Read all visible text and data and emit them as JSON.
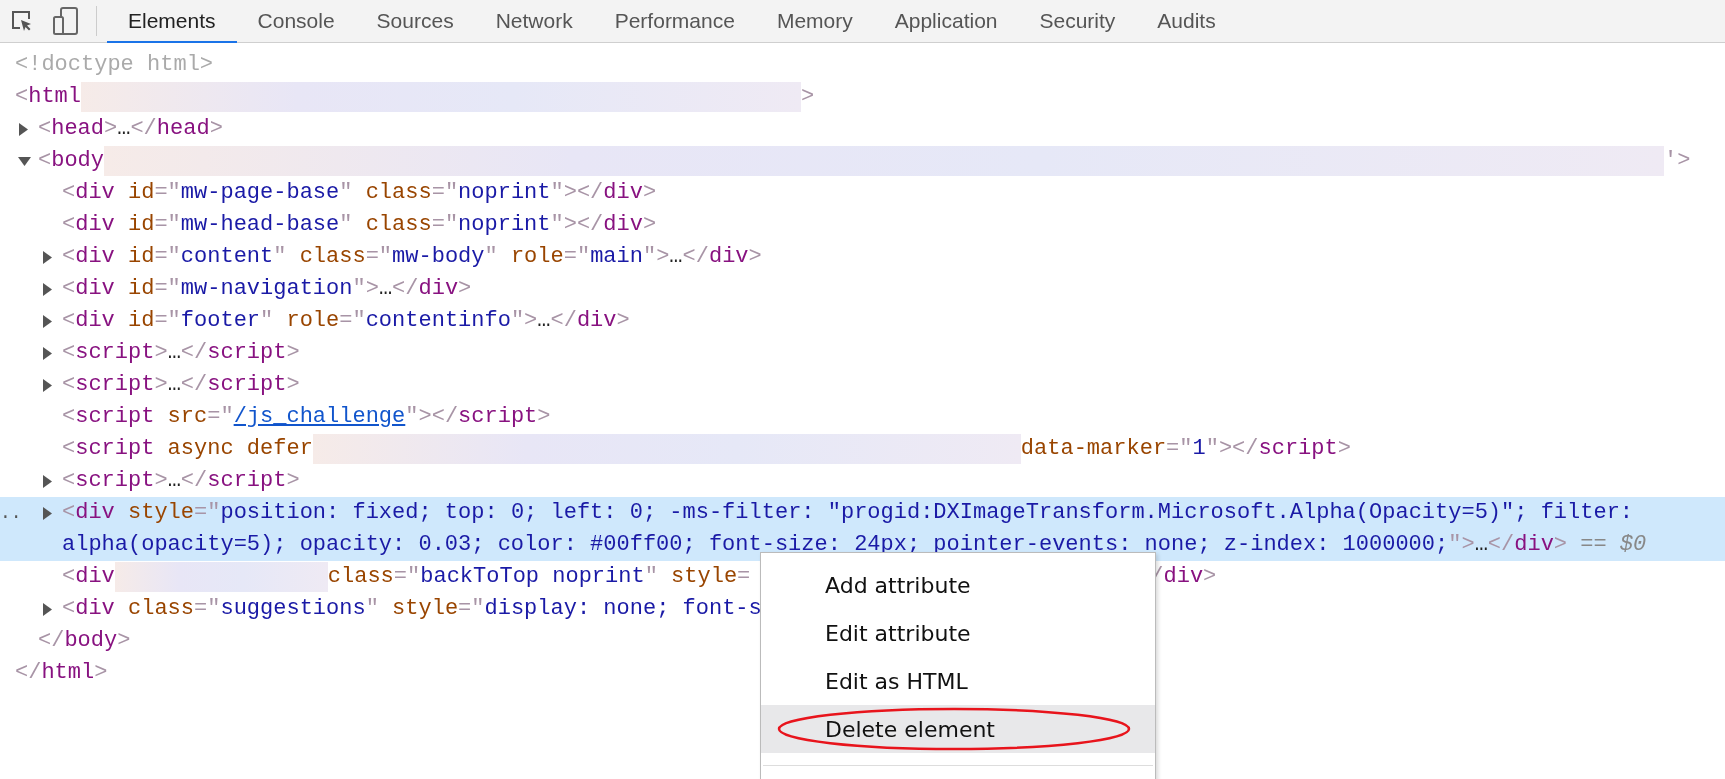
{
  "toolbar": {
    "tabs": [
      {
        "label": "Elements",
        "selected": true
      },
      {
        "label": "Console",
        "selected": false
      },
      {
        "label": "Sources",
        "selected": false
      },
      {
        "label": "Network",
        "selected": false
      },
      {
        "label": "Performance",
        "selected": false
      },
      {
        "label": "Memory",
        "selected": false
      },
      {
        "label": "Application",
        "selected": false
      },
      {
        "label": "Security",
        "selected": false
      },
      {
        "label": "Audits",
        "selected": false
      }
    ]
  },
  "dom_tree": [
    {
      "selected": false,
      "tokens": [
        {
          "kind": "comment",
          "text": "<!doctype html>"
        }
      ]
    },
    {
      "selected": false,
      "tokens": [
        {
          "kind": "punct",
          "text": "<"
        },
        {
          "kind": "tag",
          "text": "html"
        },
        {
          "kind": "redacted"
        },
        {
          "kind": "punct",
          "text": ">"
        }
      ],
      "children": [
        {
          "expandable": true,
          "expanded": false,
          "selected": false,
          "tokens": [
            {
              "kind": "punct",
              "text": "<"
            },
            {
              "kind": "tag",
              "text": "head"
            },
            {
              "kind": "punct",
              "text": ">"
            },
            {
              "kind": "text",
              "text": "…"
            },
            {
              "kind": "punct",
              "text": "</"
            },
            {
              "kind": "tag",
              "text": "head"
            },
            {
              "kind": "punct",
              "text": ">"
            }
          ]
        },
        {
          "expandable": true,
          "expanded": true,
          "selected": false,
          "tokens": [
            {
              "kind": "punct",
              "text": "<"
            },
            {
              "kind": "tag",
              "text": "body"
            },
            {
              "kind": "redacted"
            },
            {
              "kind": "punct",
              "text": "'>"
            }
          ],
          "children": [
            {
              "expandable": false,
              "selected": false,
              "tokens": [
                {
                  "kind": "punct",
                  "text": "<"
                },
                {
                  "kind": "tag",
                  "text": "div"
                },
                {
                  "kind": "attr",
                  "text": " id"
                },
                {
                  "kind": "punct",
                  "text": "=\""
                },
                {
                  "kind": "value",
                  "text": "mw-page-base"
                },
                {
                  "kind": "punct",
                  "text": "\""
                },
                {
                  "kind": "attr",
                  "text": " class"
                },
                {
                  "kind": "punct",
                  "text": "=\""
                },
                {
                  "kind": "value",
                  "text": "noprint"
                },
                {
                  "kind": "punct",
                  "text": "\"></"
                },
                {
                  "kind": "tag",
                  "text": "div"
                },
                {
                  "kind": "punct",
                  "text": ">"
                }
              ]
            },
            {
              "expandable": false,
              "selected": false,
              "tokens": [
                {
                  "kind": "punct",
                  "text": "<"
                },
                {
                  "kind": "tag",
                  "text": "div"
                },
                {
                  "kind": "attr",
                  "text": " id"
                },
                {
                  "kind": "punct",
                  "text": "=\""
                },
                {
                  "kind": "value",
                  "text": "mw-head-base"
                },
                {
                  "kind": "punct",
                  "text": "\""
                },
                {
                  "kind": "attr",
                  "text": " class"
                },
                {
                  "kind": "punct",
                  "text": "=\""
                },
                {
                  "kind": "value",
                  "text": "noprint"
                },
                {
                  "kind": "punct",
                  "text": "\"></"
                },
                {
                  "kind": "tag",
                  "text": "div"
                },
                {
                  "kind": "punct",
                  "text": ">"
                }
              ]
            },
            {
              "expandable": true,
              "expanded": false,
              "selected": false,
              "tokens": [
                {
                  "kind": "punct",
                  "text": "<"
                },
                {
                  "kind": "tag",
                  "text": "div"
                },
                {
                  "kind": "attr",
                  "text": " id"
                },
                {
                  "kind": "punct",
                  "text": "=\""
                },
                {
                  "kind": "value",
                  "text": "content"
                },
                {
                  "kind": "punct",
                  "text": "\""
                },
                {
                  "kind": "attr",
                  "text": " class"
                },
                {
                  "kind": "punct",
                  "text": "=\""
                },
                {
                  "kind": "value",
                  "text": "mw-body"
                },
                {
                  "kind": "punct",
                  "text": "\""
                },
                {
                  "kind": "attr",
                  "text": " role"
                },
                {
                  "kind": "punct",
                  "text": "=\""
                },
                {
                  "kind": "value",
                  "text": "main"
                },
                {
                  "kind": "punct",
                  "text": "\">"
                },
                {
                  "kind": "text",
                  "text": "…"
                },
                {
                  "kind": "punct",
                  "text": "</"
                },
                {
                  "kind": "tag",
                  "text": "div"
                },
                {
                  "kind": "punct",
                  "text": ">"
                }
              ]
            },
            {
              "expandable": true,
              "expanded": false,
              "selected": false,
              "tokens": [
                {
                  "kind": "punct",
                  "text": "<"
                },
                {
                  "kind": "tag",
                  "text": "div"
                },
                {
                  "kind": "attr",
                  "text": " id"
                },
                {
                  "kind": "punct",
                  "text": "=\""
                },
                {
                  "kind": "value",
                  "text": "mw-navigation"
                },
                {
                  "kind": "punct",
                  "text": "\">"
                },
                {
                  "kind": "text",
                  "text": "…"
                },
                {
                  "kind": "punct",
                  "text": "</"
                },
                {
                  "kind": "tag",
                  "text": "div"
                },
                {
                  "kind": "punct",
                  "text": ">"
                }
              ]
            },
            {
              "expandable": true,
              "expanded": false,
              "selected": false,
              "tokens": [
                {
                  "kind": "punct",
                  "text": "<"
                },
                {
                  "kind": "tag",
                  "text": "div"
                },
                {
                  "kind": "attr",
                  "text": " id"
                },
                {
                  "kind": "punct",
                  "text": "=\""
                },
                {
                  "kind": "value",
                  "text": "footer"
                },
                {
                  "kind": "punct",
                  "text": "\""
                },
                {
                  "kind": "attr",
                  "text": " role"
                },
                {
                  "kind": "punct",
                  "text": "=\""
                },
                {
                  "kind": "value",
                  "text": "contentinfo"
                },
                {
                  "kind": "punct",
                  "text": "\">"
                },
                {
                  "kind": "text",
                  "text": "…"
                },
                {
                  "kind": "punct",
                  "text": "</"
                },
                {
                  "kind": "tag",
                  "text": "div"
                },
                {
                  "kind": "punct",
                  "text": ">"
                }
              ]
            },
            {
              "expandable": true,
              "expanded": false,
              "selected": false,
              "tokens": [
                {
                  "kind": "punct",
                  "text": "<"
                },
                {
                  "kind": "tag",
                  "text": "script"
                },
                {
                  "kind": "punct",
                  "text": ">"
                },
                {
                  "kind": "text",
                  "text": "…"
                },
                {
                  "kind": "punct",
                  "text": "</"
                },
                {
                  "kind": "tag",
                  "text": "script"
                },
                {
                  "kind": "punct",
                  "text": ">"
                }
              ]
            },
            {
              "expandable": true,
              "expanded": false,
              "selected": false,
              "tokens": [
                {
                  "kind": "punct",
                  "text": "<"
                },
                {
                  "kind": "tag",
                  "text": "script"
                },
                {
                  "kind": "punct",
                  "text": ">"
                },
                {
                  "kind": "text",
                  "text": "…"
                },
                {
                  "kind": "punct",
                  "text": "</"
                },
                {
                  "kind": "tag",
                  "text": "script"
                },
                {
                  "kind": "punct",
                  "text": ">"
                }
              ]
            },
            {
              "expandable": false,
              "selected": false,
              "tokens": [
                {
                  "kind": "punct",
                  "text": "<"
                },
                {
                  "kind": "tag",
                  "text": "script"
                },
                {
                  "kind": "attr",
                  "text": " src"
                },
                {
                  "kind": "punct",
                  "text": "=\""
                },
                {
                  "kind": "link",
                  "text": "/js_challenge"
                },
                {
                  "kind": "punct",
                  "text": "\"></"
                },
                {
                  "kind": "tag",
                  "text": "script"
                },
                {
                  "kind": "punct",
                  "text": ">"
                }
              ]
            },
            {
              "expandable": false,
              "selected": false,
              "tokens": [
                {
                  "kind": "punct",
                  "text": "<"
                },
                {
                  "kind": "tag",
                  "text": "script"
                },
                {
                  "kind": "attr",
                  "text": " async defer"
                },
                {
                  "kind": "redacted"
                },
                {
                  "kind": "attr",
                  "text": "data-marker"
                },
                {
                  "kind": "punct",
                  "text": "=\""
                },
                {
                  "kind": "value",
                  "text": "1"
                },
                {
                  "kind": "punct",
                  "text": "\"></"
                },
                {
                  "kind": "tag",
                  "text": "script"
                },
                {
                  "kind": "punct",
                  "text": ">"
                }
              ]
            },
            {
              "expandable": true,
              "expanded": false,
              "selected": false,
              "tokens": [
                {
                  "kind": "punct",
                  "text": "<"
                },
                {
                  "kind": "tag",
                  "text": "script"
                },
                {
                  "kind": "punct",
                  "text": ">"
                },
                {
                  "kind": "text",
                  "text": "…"
                },
                {
                  "kind": "punct",
                  "text": "</"
                },
                {
                  "kind": "tag",
                  "text": "script"
                },
                {
                  "kind": "punct",
                  "text": ">"
                }
              ]
            },
            {
              "expandable": true,
              "expanded": false,
              "selected": true,
              "gutter": "..",
              "tokens": [
                {
                  "kind": "punct",
                  "text": "<"
                },
                {
                  "kind": "tag",
                  "text": "div"
                },
                {
                  "kind": "attr",
                  "text": " style"
                },
                {
                  "kind": "punct",
                  "text": "=\""
                },
                {
                  "kind": "value",
                  "text": "position: fixed; top: 0; left: 0; -ms-filter: \"progid:DXImageTransform.Microsoft.Alpha(Opacity=5)\"; filter: alpha(opacity=5); opacity: 0.03; color: #00ff00; font-size: 24px; pointer-events: none; z-index: 1000000;"
                },
                {
                  "kind": "punct",
                  "text": "\">"
                },
                {
                  "kind": "text",
                  "text": "…"
                },
                {
                  "kind": "punct",
                  "text": "</"
                },
                {
                  "kind": "tag",
                  "text": "div"
                },
                {
                  "kind": "punct",
                  "text": ">"
                },
                {
                  "kind": "hint",
                  "text": " == $0"
                }
              ]
            },
            {
              "expandable": false,
              "selected": false,
              "tokens": [
                {
                  "kind": "punct",
                  "text": "<"
                },
                {
                  "kind": "tag",
                  "text": "div"
                },
                {
                  "kind": "redacted"
                },
                {
                  "kind": "attr",
                  "text": "class"
                },
                {
                  "kind": "punct",
                  "text": "=\""
                },
                {
                  "kind": "value",
                  "text": "backToTop noprint"
                },
                {
                  "kind": "punct",
                  "text": "\""
                },
                {
                  "kind": "attr",
                  "text": " style"
                },
                {
                  "kind": "punct",
                  "text": "="
                },
                {
                  "kind": "covered"
                },
                {
                  "kind": "punct",
                  "text": "/"
                },
                {
                  "kind": "tag",
                  "text": "div"
                },
                {
                  "kind": "punct",
                  "text": ">"
                }
              ]
            },
            {
              "expandable": true,
              "expanded": false,
              "selected": false,
              "tokens": [
                {
                  "kind": "punct",
                  "text": "<"
                },
                {
                  "kind": "tag",
                  "text": "div"
                },
                {
                  "kind": "attr",
                  "text": " class"
                },
                {
                  "kind": "punct",
                  "text": "=\""
                },
                {
                  "kind": "value",
                  "text": "suggestions"
                },
                {
                  "kind": "punct",
                  "text": "\""
                },
                {
                  "kind": "attr",
                  "text": " style"
                },
                {
                  "kind": "punct",
                  "text": "=\""
                },
                {
                  "kind": "value",
                  "text": "display: none; font-s"
                }
              ]
            }
          ],
          "closing": [
            {
              "kind": "punct",
              "text": "</"
            },
            {
              "kind": "tag",
              "text": "body"
            },
            {
              "kind": "punct",
              "text": ">"
            }
          ]
        }
      ],
      "closing": [
        {
          "kind": "punct",
          "text": "</"
        },
        {
          "kind": "tag",
          "text": "html"
        },
        {
          "kind": "punct",
          "text": ">"
        }
      ]
    }
  ],
  "context_menu": {
    "items": [
      {
        "label": "Add attribute",
        "selected": false,
        "circled": false
      },
      {
        "label": "Edit attribute",
        "selected": false,
        "circled": false
      },
      {
        "label": "Edit as HTML",
        "selected": false,
        "circled": false
      },
      {
        "label": "Delete element",
        "selected": true,
        "circled": true
      }
    ]
  }
}
